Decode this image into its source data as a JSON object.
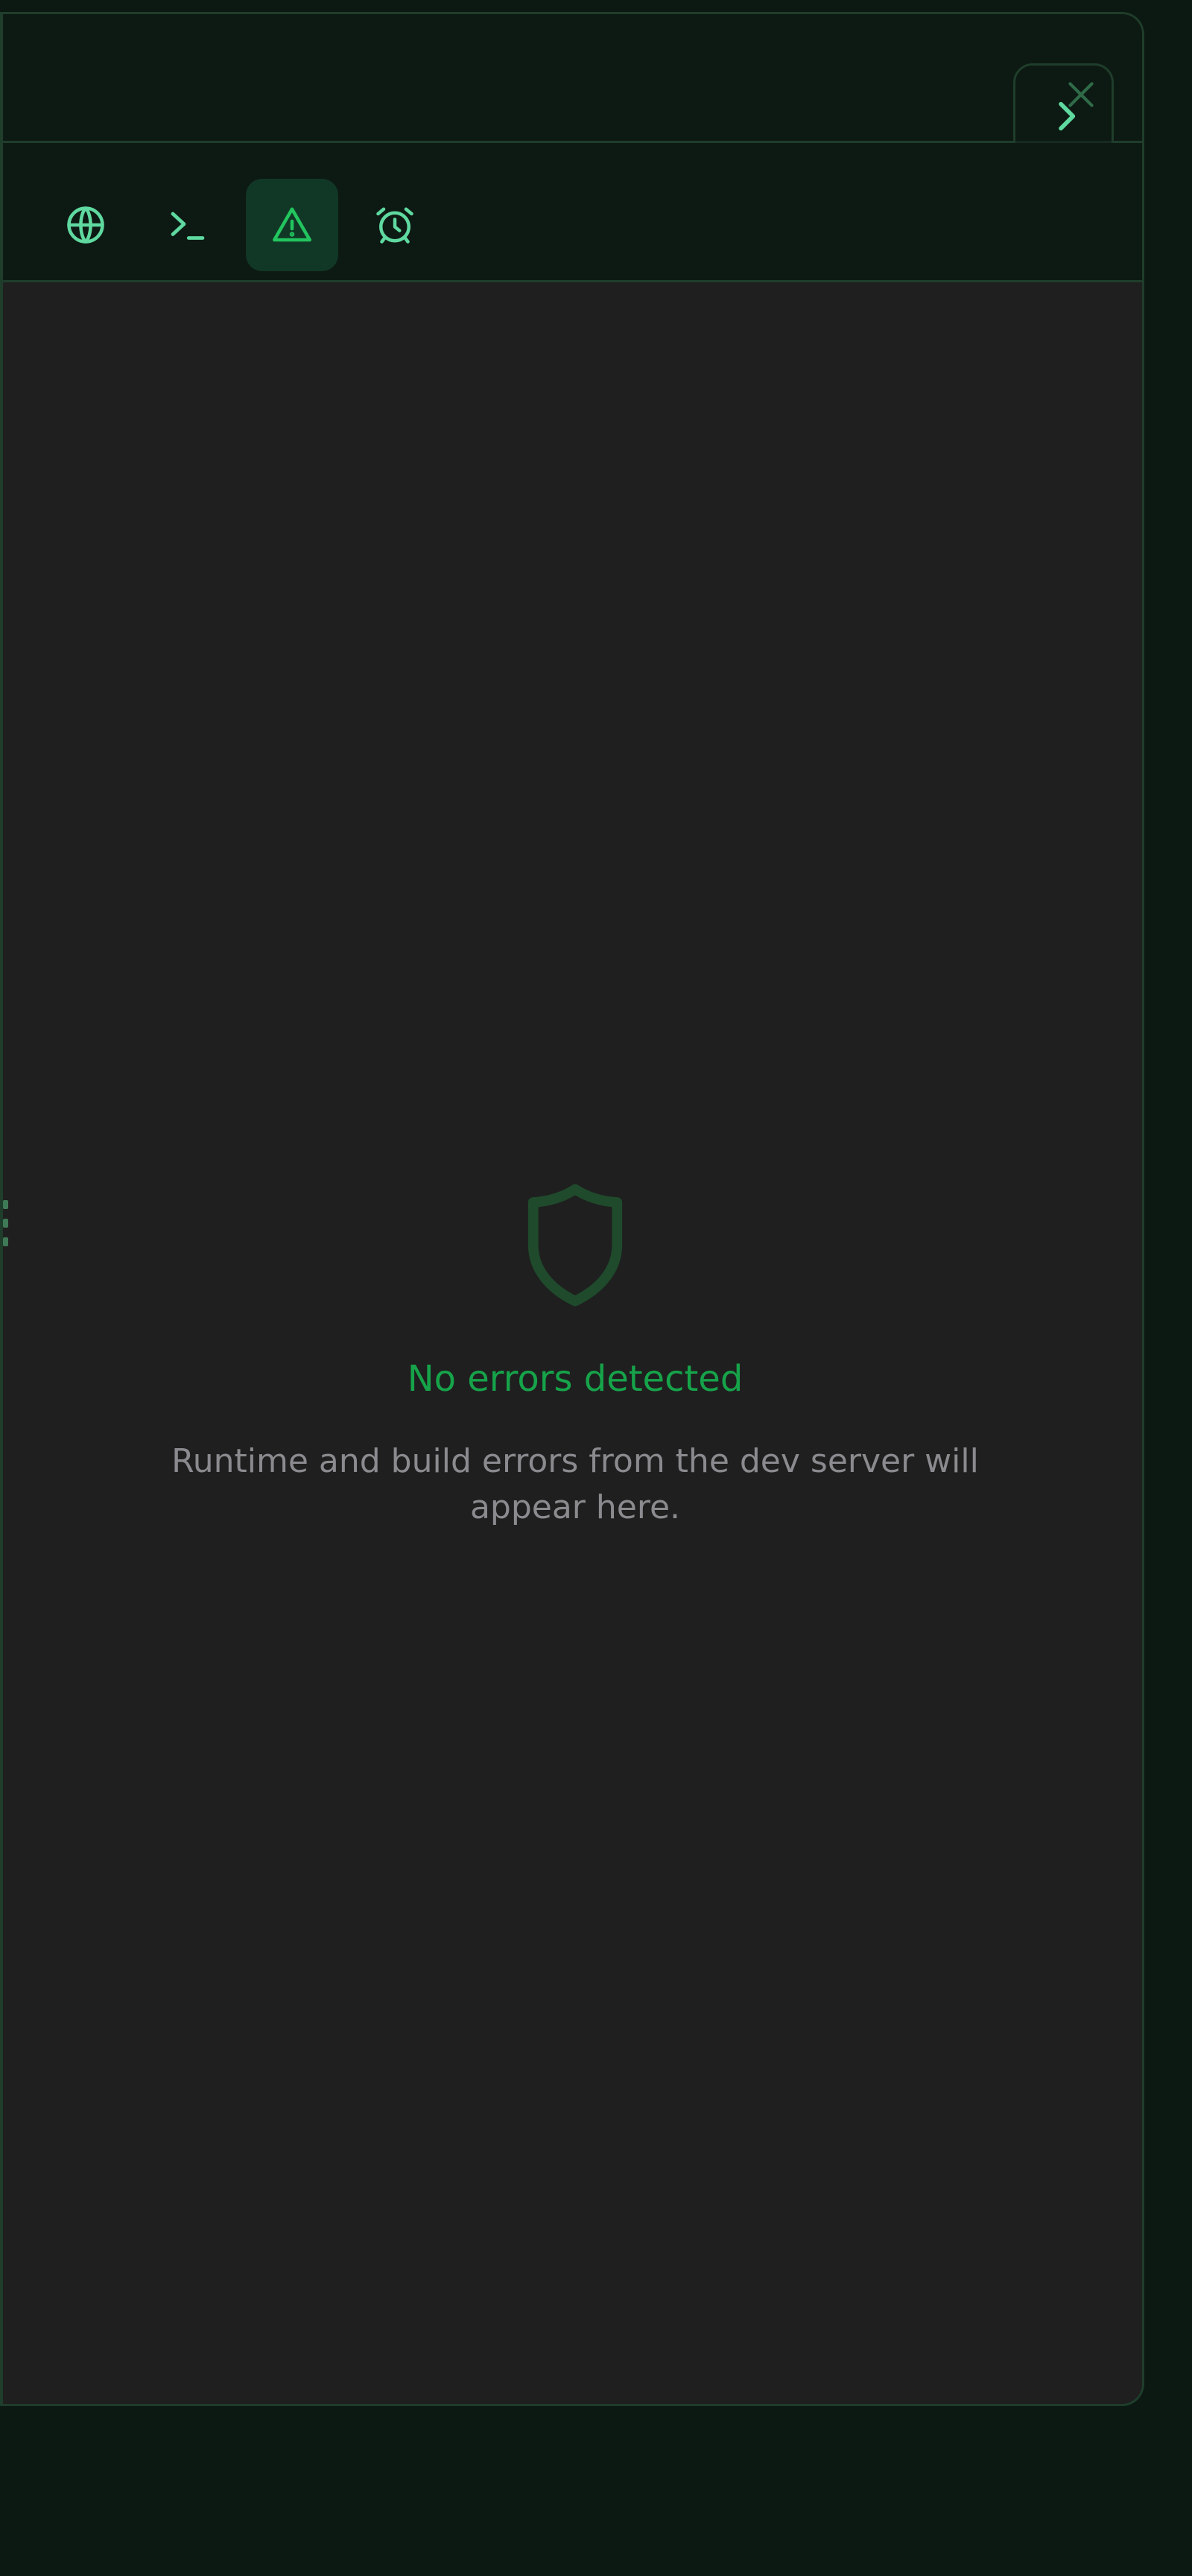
{
  "tabs": [
    {
      "id": "preview",
      "icon": "globe-icon"
    },
    {
      "id": "terminal",
      "icon": "terminal-icon"
    },
    {
      "id": "errors",
      "icon": "warning-triangle-icon",
      "active": true
    },
    {
      "id": "timers",
      "icon": "alarm-clock-icon"
    }
  ],
  "header": {
    "collapse_icon": "chevron-right-icon",
    "close_icon": "close-icon"
  },
  "empty_state": {
    "icon": "shield-icon",
    "title": "No errors detected",
    "description": "Runtime and build errors from the dev server will appear here."
  },
  "colors": {
    "accent": "#16a34a",
    "icon": "#5fd9a0",
    "shield": "#1f4a2c",
    "muted_text": "#8a8a8f",
    "panel_bg": "#1f1f1f",
    "header_bg": "#0d1a13",
    "border": "#1f3d2b"
  }
}
